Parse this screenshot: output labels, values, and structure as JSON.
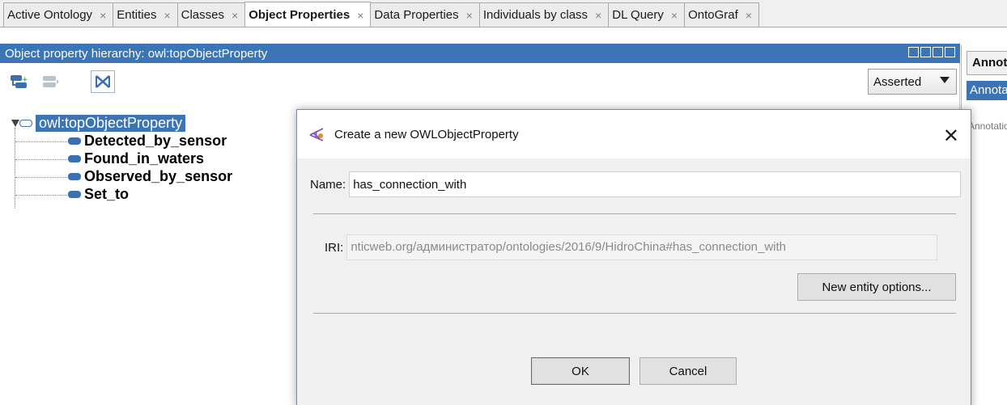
{
  "tabs": [
    {
      "label": "Active Ontology",
      "active": false
    },
    {
      "label": "Entities",
      "active": false
    },
    {
      "label": "Classes",
      "active": false
    },
    {
      "label": "Object Properties",
      "active": true
    },
    {
      "label": "Data Properties",
      "active": false
    },
    {
      "label": "Individuals by class",
      "active": false
    },
    {
      "label": "DL Query",
      "active": false
    },
    {
      "label": "OntoGraf",
      "active": false
    }
  ],
  "tab_close_glyph": "×",
  "hierarchy": {
    "title": "Object property hierarchy: owl:topObjectProperty",
    "view_mode": "Asserted",
    "root": "owl:topObjectProperty",
    "children": [
      "Detected_by_sensor",
      "Found_in_waters",
      "Observed_by_sensor",
      "Set_to"
    ]
  },
  "right_panel": {
    "tab1": "Annotations",
    "tab2": "Annotations",
    "text3": "Annotations"
  },
  "dialog": {
    "title": "Create a new OWLObjectProperty",
    "name_label": "Name:",
    "name_value": "has_connection_with",
    "iri_label": "IRI:",
    "iri_value": "nticweb.org/администратор/ontologies/2016/9/HidroChina#has_connection_with",
    "new_entity_options_label": "New entity options...",
    "ok_label": "OK",
    "cancel_label": "Cancel"
  },
  "colors": {
    "selection_blue": "#3b75b5",
    "property_icon": "#3b6fb0"
  }
}
